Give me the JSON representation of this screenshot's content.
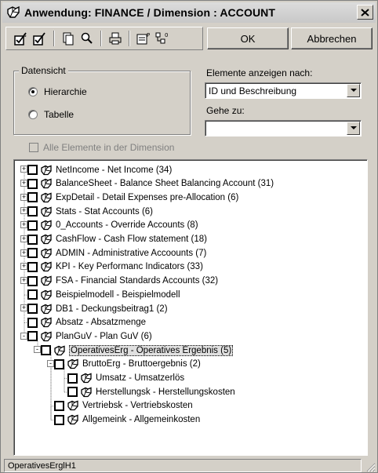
{
  "window": {
    "title": "Anwendung: FINANCE / Dimension : ACCOUNT"
  },
  "buttons": {
    "ok": "OK",
    "cancel": "Abbrechen"
  },
  "datensicht": {
    "legend": "Datensicht",
    "options": [
      {
        "label": "Hierarchie",
        "selected": true
      },
      {
        "label": "Tabelle",
        "selected": false
      }
    ]
  },
  "elements_display": {
    "label": "Elemente anzeigen nach:",
    "value": "ID und Beschreibung"
  },
  "goto": {
    "label": "Gehe zu:",
    "value": ""
  },
  "all_elements": {
    "label": "Alle Elemente in der Dimension",
    "checked": false,
    "enabled": false
  },
  "tree": [
    {
      "text": "NetIncome - Net Income (34)",
      "level": 0,
      "expander": "+"
    },
    {
      "text": "BalanceSheet - Balance Sheet Balancing Account (31)",
      "level": 0,
      "expander": "+"
    },
    {
      "text": "ExpDetail - Detail Expenses pre-Allocation (6)",
      "level": 0,
      "expander": "+"
    },
    {
      "text": "Stats - Stat Accounts (6)",
      "level": 0,
      "expander": "+"
    },
    {
      "text": "0_Accounts - Override Accounts (8)",
      "level": 0,
      "expander": "+"
    },
    {
      "text": "CashFlow - Cash Flow statement (18)",
      "level": 0,
      "expander": "+"
    },
    {
      "text": "ADMIN - Administrative Accoounts (7)",
      "level": 0,
      "expander": "+"
    },
    {
      "text": "KPI - Key Performanc Indicators (33)",
      "level": 0,
      "expander": "+"
    },
    {
      "text": "FSA - Financial Standards Accounts (32)",
      "level": 0,
      "expander": "+"
    },
    {
      "text": "Beispielmodell - Beispielmodell",
      "level": 0,
      "expander": ""
    },
    {
      "text": "DB1 - Deckungsbeitrag1 (2)",
      "level": 0,
      "expander": "+"
    },
    {
      "text": "Absatz - Absatzmenge",
      "level": 0,
      "expander": ""
    },
    {
      "text": "PlanGuV - Plan GuV (6)",
      "level": 0,
      "expander": "-"
    },
    {
      "text": "OperativesErg - Operatives Ergebnis (5)",
      "level": 1,
      "expander": "-",
      "selected": true
    },
    {
      "text": "BruttoErg - Bruttoergebnis (2)",
      "level": 2,
      "expander": "-"
    },
    {
      "text": "Umsatz - Umsatzerlös",
      "level": 3,
      "expander": ""
    },
    {
      "text": "Herstellungsk - Herstellungskosten",
      "level": 3,
      "expander": ""
    },
    {
      "text": "Vertriebsk - Vertriebskosten",
      "level": 2,
      "expander": ""
    },
    {
      "text": "Allgemeink - Allgemeinkosten",
      "level": 2,
      "expander": ""
    }
  ],
  "status": {
    "text": "OperativesErglH1"
  },
  "icons": [
    "app-icon",
    "close-icon",
    "check-all-icon",
    "uncheck-icon",
    "copy-icon",
    "find-icon",
    "print-icon",
    "properties-icon",
    "hierarchy-icon",
    "dropdown-arrow-icon",
    "member-icon",
    "resize-grip-icon"
  ]
}
